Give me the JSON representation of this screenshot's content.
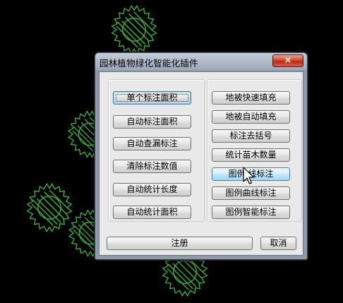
{
  "window": {
    "title": "园林植物绿化智能化插件",
    "close_glyph": "×"
  },
  "left_buttons": [
    {
      "label": "单个标注面积"
    },
    {
      "label": "自动标注面积"
    },
    {
      "label": "自动查漏标注"
    },
    {
      "label": "清除标注数值"
    },
    {
      "label": "自动统计长度"
    },
    {
      "label": "自动统计面积"
    }
  ],
  "right_buttons": [
    {
      "label": "地被快速填充"
    },
    {
      "label": "地被自动填充"
    },
    {
      "label": "标注去括号"
    },
    {
      "label": "统计苗木数量"
    },
    {
      "label": "图例 线标注"
    },
    {
      "label": "图例曲线标注"
    },
    {
      "label": "图例智能标注"
    }
  ],
  "footer": {
    "register_label": "注册",
    "cancel_label": "取消"
  },
  "colors": {
    "background": "#000000",
    "plant_symbol": "#3fbf3f",
    "hover_button": "#bee6fd"
  },
  "icons": [
    "plant-symbol-icon",
    "close-icon",
    "mouse-cursor-icon"
  ]
}
